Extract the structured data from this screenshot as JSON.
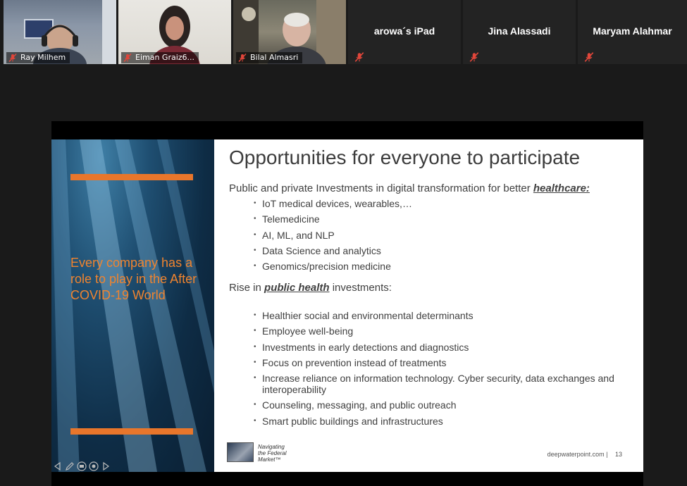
{
  "participants": [
    {
      "name": "Ray Milhem",
      "video": true,
      "muted": true
    },
    {
      "name": "Eiman Graiz6...",
      "video": true,
      "muted": true
    },
    {
      "name": "Bilal Almasri",
      "video": true,
      "muted": true
    },
    {
      "name": "arowa´s iPad",
      "video": false,
      "muted": true
    },
    {
      "name": "Jina Alassadi",
      "video": false,
      "muted": true
    },
    {
      "name": "Maryam Alahmar",
      "video": false,
      "muted": true
    }
  ],
  "slide": {
    "left_tagline": "Every company has a role to play in the After COVID-19 World",
    "title": "Opportunities for everyone to participate",
    "section1": {
      "intro_text": "Public and private Investments in digital transformation for better",
      "intro_emphasis": "healthcare:",
      "bullets": [
        "IoT medical devices, wearables,…",
        "Telemedicine",
        "AI, ML, and NLP",
        "Data Science and analytics",
        "Genomics/precision medicine"
      ]
    },
    "section2": {
      "intro_prefix": "Rise in",
      "intro_emphasis": "public health",
      "intro_suffix": "investments:",
      "bullets": [
        "Healthier social and environmental determinants",
        "Employee well-being",
        "Investments in early detections and diagnostics",
        "Focus on prevention instead of treatments",
        "Increase reliance on information technology. Cyber security, data exchanges and interoperability",
        "Counseling, messaging, and public outreach",
        "Smart public buildings and infrastructures"
      ]
    },
    "footer": {
      "logo_caption": "Navigating the Federal Market™",
      "url": "deepwaterpoint.com |",
      "page_number": "13"
    },
    "nav_icons": [
      "prev-arrow-icon",
      "pen-icon",
      "slides-icon",
      "zoom-icon",
      "next-arrow-icon"
    ]
  },
  "colors": {
    "background": "#1a1a1a",
    "accent_orange": "#e8762b",
    "muted_red": "#e0463a"
  }
}
